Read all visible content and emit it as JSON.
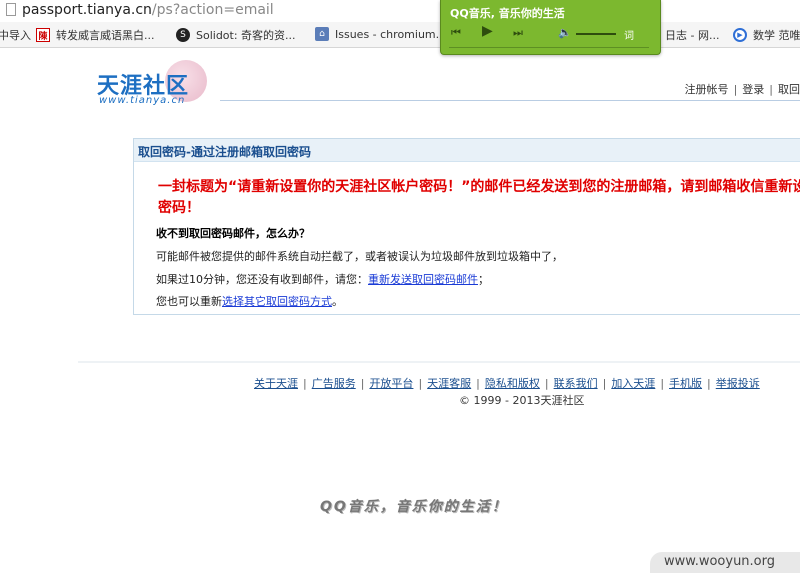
{
  "browser": {
    "url_host": "passport.tianya.cn",
    "url_path": "/ps?action=email",
    "bookmarks": [
      {
        "label": "中导入",
        "icon": "none"
      },
      {
        "label": "转发威言威语黑白...",
        "icon": "chen-favicon"
      },
      {
        "label": "Solidot: 奇客的资...",
        "icon": "solidot-favicon"
      },
      {
        "label": "Issues - chromium...",
        "icon": "chromium-favicon"
      },
      {
        "label": "日志 - 网...",
        "icon": "none"
      },
      {
        "label": "数学 范唯",
        "icon": "play-circle-favicon"
      }
    ]
  },
  "qq_music": {
    "title": "QQ音乐, 音乐你的生活",
    "lyric_label": "词"
  },
  "logo": {
    "text": "天涯社区",
    "url": "www.tianya.cn"
  },
  "topnav": {
    "register": "注册帐号",
    "login": "登录",
    "retrieve": "取回"
  },
  "panel": {
    "heading": "取回密码-通过注册邮箱取回密码",
    "notice": "一封标题为“请重新设置你的天涯社区帐户密码！”的邮件已经发送到您的注册邮箱，请到邮箱收信重新设密码！",
    "question": "收不到取回密码邮件，怎么办？",
    "line1": "可能邮件被您提供的邮件系统自动拦截了，或者被误认为垃圾邮件放到垃圾箱中了，",
    "line2_prefix": "如果过10分钟，您还没有收到邮件，请您：",
    "line2_link": "重新发送取回密码邮件",
    "line2_suffix": "；",
    "line3_prefix": "您也可以重新",
    "line3_link": "选择其它取回密码方式",
    "line3_suffix": "。"
  },
  "footer": {
    "links": [
      "关于天涯",
      "广告服务",
      "开放平台",
      "天涯客服",
      "隐私和版权",
      "联系我们",
      "加入天涯",
      "手机版",
      "举报投诉"
    ],
    "copyright": "© 1999 - 2013天涯社区"
  },
  "slogan": "QQ音乐，音乐你的生活！",
  "watermark": "www.wooyun.org"
}
